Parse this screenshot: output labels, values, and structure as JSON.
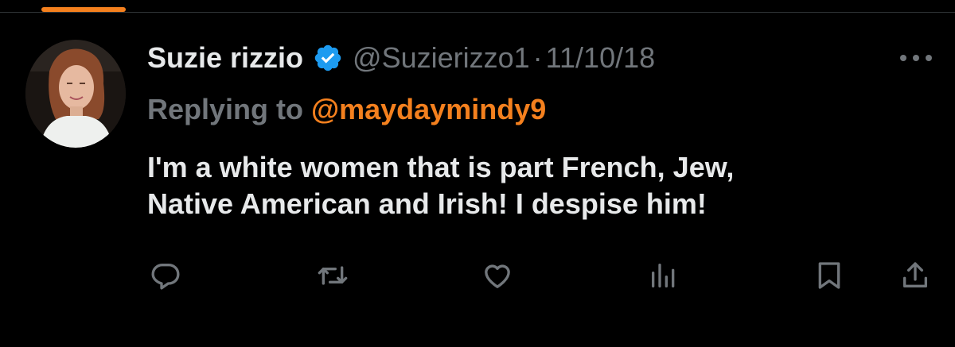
{
  "colors": {
    "background": "#000000",
    "text_primary": "#e7e9ea",
    "text_secondary": "#71767b",
    "accent": "#f4801e",
    "verified": "#1d9bf0",
    "divider": "#2f3336"
  },
  "tweet": {
    "author": {
      "display_name": "Suzie rizzio",
      "handle": "@Suzierizzo1",
      "verified": true,
      "avatar_icon": "profile-photo"
    },
    "separator": "·",
    "date": "11/10/18",
    "reply": {
      "prefix": "Replying to",
      "target": "@maydaymindy9"
    },
    "text_lines": [
      "I'm a white women that is part French, Jew,",
      "Native American and Irish! I despise him!"
    ]
  },
  "actions": [
    {
      "name": "reply",
      "icon": "reply-bubble-icon"
    },
    {
      "name": "repost",
      "icon": "repost-icon"
    },
    {
      "name": "like",
      "icon": "heart-icon"
    },
    {
      "name": "views",
      "icon": "bar-chart-icon"
    },
    {
      "name": "bookmark",
      "icon": "bookmark-icon"
    },
    {
      "name": "share",
      "icon": "share-upload-icon"
    }
  ]
}
